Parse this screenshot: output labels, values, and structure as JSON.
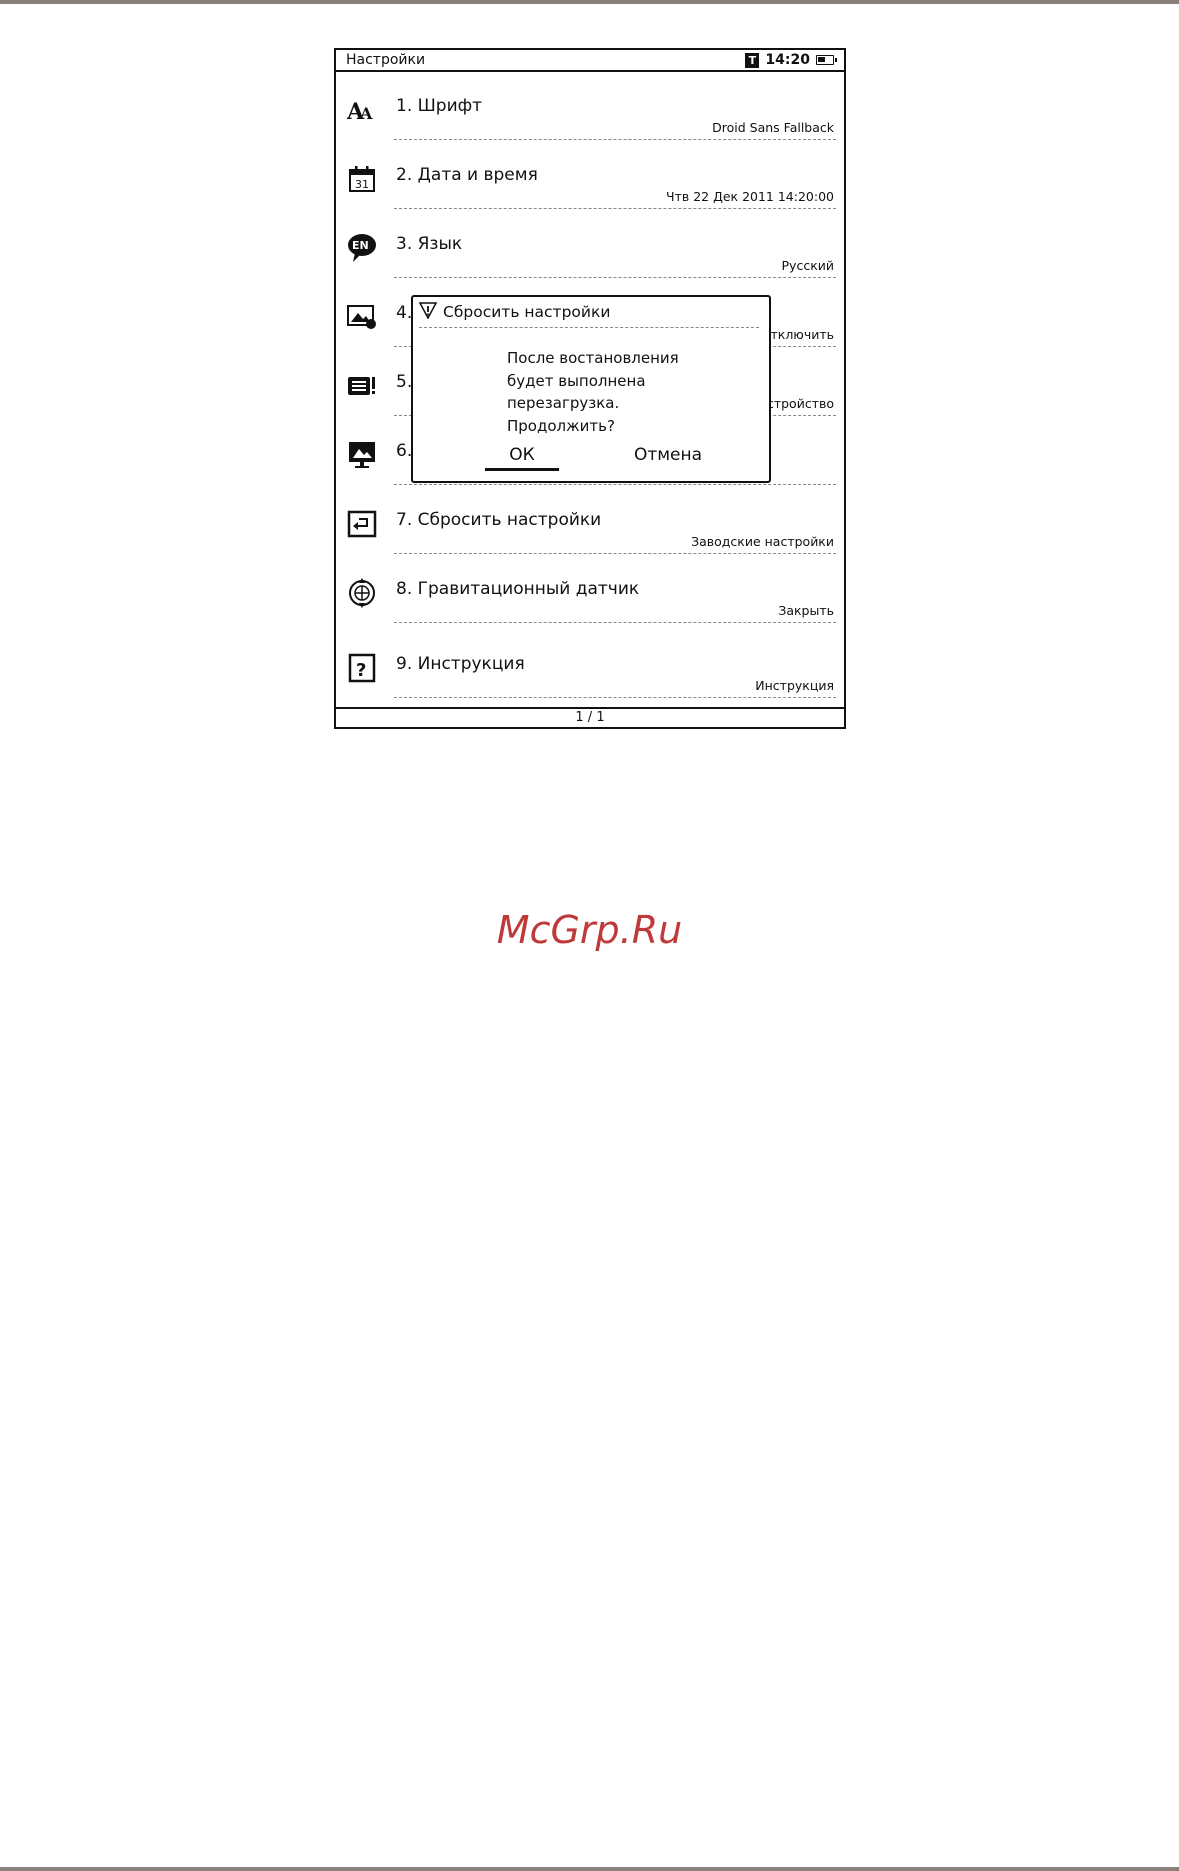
{
  "status_bar": {
    "title": "Настройки",
    "badge": "T",
    "time": "14:20",
    "battery_level": 0.55
  },
  "settings": [
    {
      "title": "1. Шрифт",
      "value": "Droid Sans Fallback",
      "icon": "font-icon"
    },
    {
      "title": "2. Дата и время",
      "value": "Чтв 22 Дек 2011 14:20:00",
      "icon": "calendar-icon"
    },
    {
      "title": "3. Язык",
      "value": "Русский",
      "icon": "language-icon"
    },
    {
      "title": "4.",
      "value": "тключить",
      "icon": "image-settings-icon"
    },
    {
      "title": "5.",
      "value": "стройство",
      "icon": "storage-icon"
    },
    {
      "title": "6.",
      "value": "",
      "icon": "screensaver-icon"
    },
    {
      "title": "7. Сбросить настройки",
      "value": "Заводские настройки",
      "icon": "reset-icon"
    },
    {
      "title": "8. Гравитационный датчик",
      "value": "Закрыть",
      "icon": "gravity-sensor-icon"
    },
    {
      "title": "9. Инструкция",
      "value": "Инструкция",
      "icon": "help-icon"
    }
  ],
  "pager": "1 / 1",
  "dialog": {
    "title": "Сбросить настройки",
    "message_lines": [
      "После востановления",
      "будет выполнена",
      "перезагрузка.",
      "Продолжить?"
    ],
    "ok_label": "ОК",
    "cancel_label": "Отмена"
  },
  "watermark": "McGrp.Ru"
}
